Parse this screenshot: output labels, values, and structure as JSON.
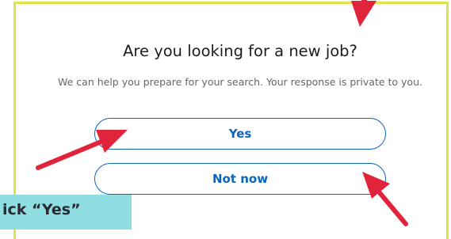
{
  "dialog": {
    "title": "Are you looking for a new job?",
    "subtitle": "We can help you prepare for your search. Your response is private to you."
  },
  "buttons": {
    "yes_label": "Yes",
    "not_now_label": "Not now"
  },
  "annotation": {
    "callout_text": "ick “Yes”"
  },
  "colors": {
    "accent": "#0a66c2",
    "arrow": "#e0243c",
    "frame": "#dfe34a",
    "callout_bg": "#8fdfe2"
  }
}
